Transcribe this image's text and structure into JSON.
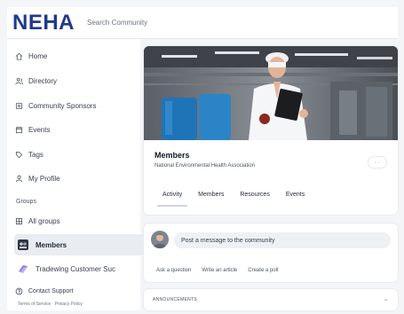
{
  "header": {
    "logo": "NEHA",
    "search_placeholder": "Search Community"
  },
  "sidebar": {
    "items": [
      {
        "label": "Home",
        "icon": "home-icon"
      },
      {
        "label": "Directory",
        "icon": "people-icon"
      },
      {
        "label": "Community Sponsors",
        "icon": "sponsor-icon"
      },
      {
        "label": "Events",
        "icon": "calendar-icon"
      },
      {
        "label": "Tags",
        "icon": "tag-icon"
      },
      {
        "label": "My Profile",
        "icon": "person-icon"
      }
    ],
    "groups_heading": "Groups",
    "all_groups": {
      "label": "All groups",
      "icon": "grid-icon"
    },
    "groups": [
      {
        "label": "Members",
        "active": true
      },
      {
        "label": "Tradewing Customer Suc",
        "active": false
      }
    ],
    "contact_support": {
      "label": "Contact Support",
      "icon": "help-icon"
    },
    "footer_links": "Terms of Service · Privacy Policy"
  },
  "group_card": {
    "title": "Members",
    "subtitle": "National Environmental Health Association",
    "more_label": "···",
    "tabs": [
      {
        "label": "Activity",
        "active": true
      },
      {
        "label": "Members",
        "active": false
      },
      {
        "label": "Resources",
        "active": false
      },
      {
        "label": "Events",
        "active": false
      }
    ]
  },
  "composer": {
    "placeholder": "Post a message to the community",
    "actions": [
      "Ask a question",
      "Write an article",
      "Create a poll"
    ]
  },
  "announcements": {
    "label": "ANNOUNCEMENTS",
    "chevron": "⌄"
  },
  "colors": {
    "brand": "#1f3a8a",
    "active_bg": "#e9ecf1",
    "panel": "#ffffff"
  }
}
